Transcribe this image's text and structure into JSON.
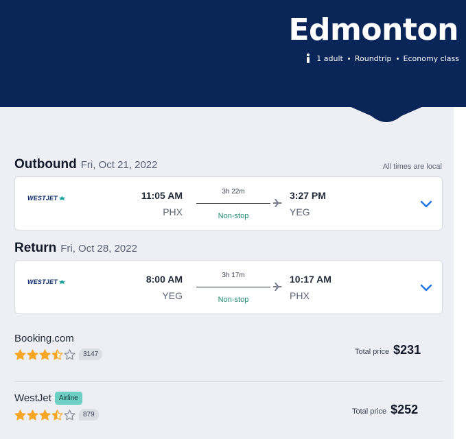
{
  "header": {
    "destination": "Edmonton",
    "passengers": "1 adult",
    "trip_type": "Roundtrip",
    "cabin": "Economy class",
    "background_color": "#0a2558"
  },
  "outbound": {
    "title": "Outbound",
    "date": "Fri, Oct 21, 2022",
    "times_note": "All times are local",
    "airline": "WESTJET",
    "departure_time": "11:05 AM",
    "departure_code": "PHX",
    "duration": "3h 22m",
    "stops": "Non-stop",
    "arrival_time": "3:27 PM",
    "arrival_code": "YEG"
  },
  "return": {
    "title": "Return",
    "date": "Fri, Oct 28, 2022",
    "airline": "WESTJET",
    "departure_time": "8:00 AM",
    "departure_code": "YEG",
    "duration": "3h 17m",
    "stops": "Non-stop",
    "arrival_time": "10:17 AM",
    "arrival_code": "PHX"
  },
  "offers": [
    {
      "provider": "Booking.com",
      "badge": "",
      "rating": 3.5,
      "reviews": "3147",
      "price_label": "Total price",
      "price": "$231"
    },
    {
      "provider": "WestJet",
      "badge": "Airline",
      "rating": 3.5,
      "reviews": "879",
      "price_label": "Total price",
      "price": "$252"
    }
  ],
  "colors": {
    "accent": "#1a73e8",
    "star": "#f5a623",
    "non_stop": "#1f8a6f",
    "badge": "#6ecfc4"
  }
}
